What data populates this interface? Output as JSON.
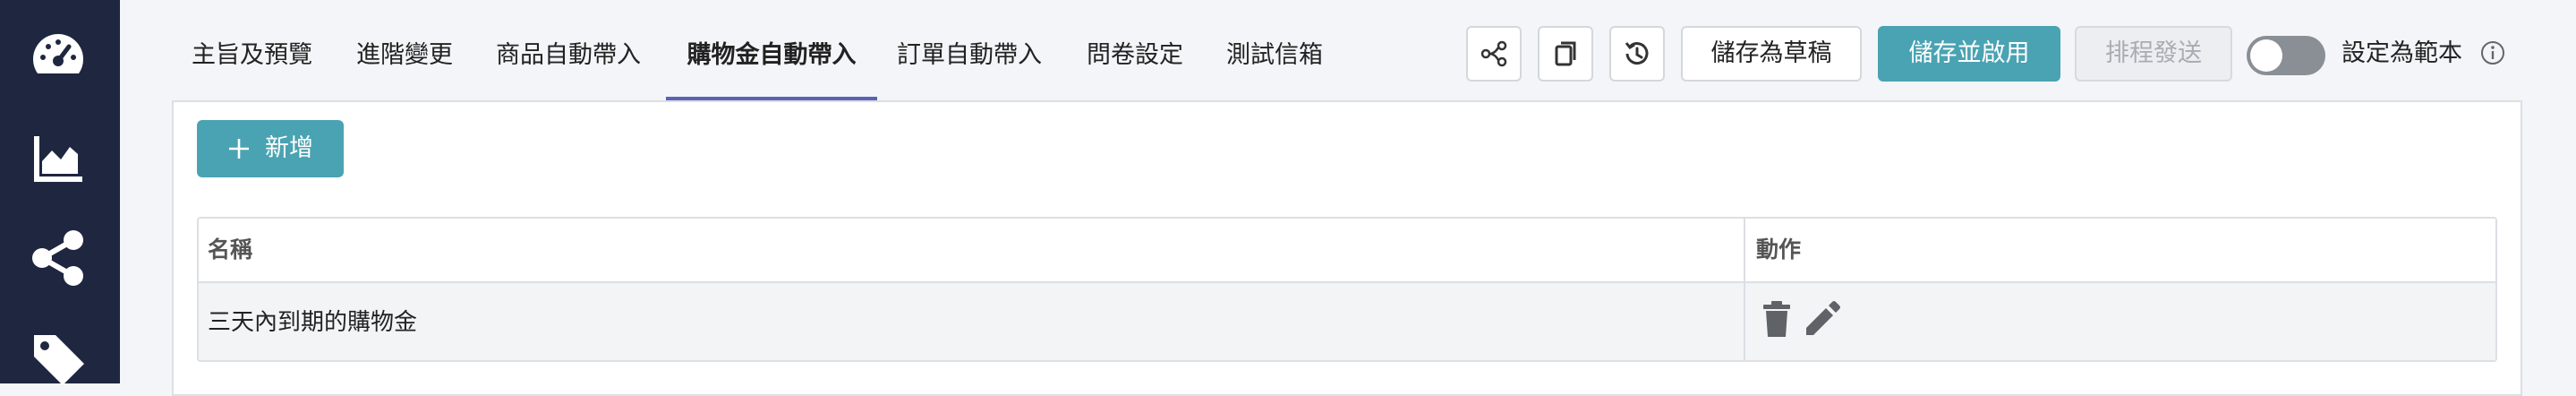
{
  "sidebar": {
    "items": [
      {
        "icon": "gauge-icon"
      },
      {
        "icon": "chart-area-icon"
      },
      {
        "icon": "share-nodes-icon"
      },
      {
        "icon": "tag-icon"
      }
    ]
  },
  "tabs": [
    {
      "label": "主旨及預覽",
      "active": false
    },
    {
      "label": "進階變更",
      "active": false
    },
    {
      "label": "商品自動帶入",
      "active": false
    },
    {
      "label": "購物金自動帶入",
      "active": true
    },
    {
      "label": "訂單自動帶入",
      "active": false
    },
    {
      "label": "問卷設定",
      "active": false
    },
    {
      "label": "測試信箱",
      "active": false
    }
  ],
  "toolbar": {
    "icons": [
      "flow-nodes-icon",
      "copy-icon",
      "history-clock-icon"
    ],
    "save_draft_label": "儲存為草稿",
    "save_enable_label": "儲存並啟用",
    "schedule_label": "排程發送",
    "template_toggle_label": "設定為範本",
    "template_toggle_on": false,
    "info_icon": "info-icon"
  },
  "colors": {
    "sidebar_bg": "#1f2640",
    "accent": "#4aa3b2",
    "tab_underline": "#5a63b8"
  },
  "panel": {
    "add_button_label": "新增",
    "table": {
      "headers": {
        "name": "名稱",
        "actions": "動作"
      },
      "rows": [
        {
          "name": "三天內到期的購物金",
          "actions": [
            "delete-icon",
            "edit-icon"
          ]
        }
      ]
    }
  }
}
